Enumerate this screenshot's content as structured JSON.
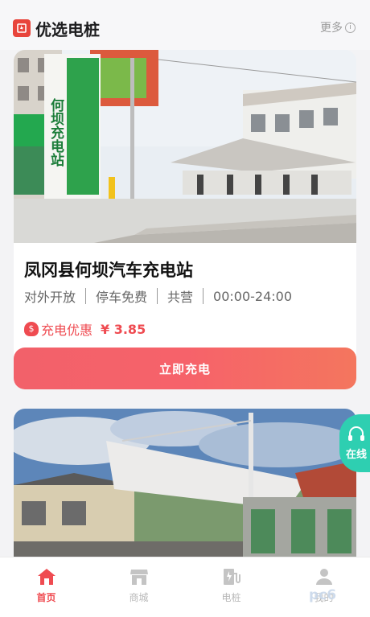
{
  "header": {
    "title": "优选电桩",
    "more_label": "更多",
    "more_icon_glyph": "i"
  },
  "station": {
    "photo_signs": [
      "何坝充电站"
    ],
    "name": "凤冈县何坝汽车充电站",
    "tags": [
      "对外开放",
      "停车免费",
      "共营",
      "00:00-24:00"
    ],
    "discount_label": "充电优惠",
    "discount_price": "¥ 3.85",
    "charge_button": "立即充电"
  },
  "online_service": {
    "label": "在线"
  },
  "tabbar": {
    "items": [
      {
        "label": "首页",
        "icon": "home-icon",
        "active": true
      },
      {
        "label": "商城",
        "icon": "shop-icon",
        "active": false
      },
      {
        "label": "电桩",
        "icon": "charger-icon",
        "active": false
      },
      {
        "label": "我的",
        "icon": "user-icon",
        "active": false
      }
    ]
  },
  "watermark": "pc6",
  "colors": {
    "accent": "#ef4b51",
    "online": "#2ecfb1",
    "tab_inactive": "#b8b8b8"
  }
}
